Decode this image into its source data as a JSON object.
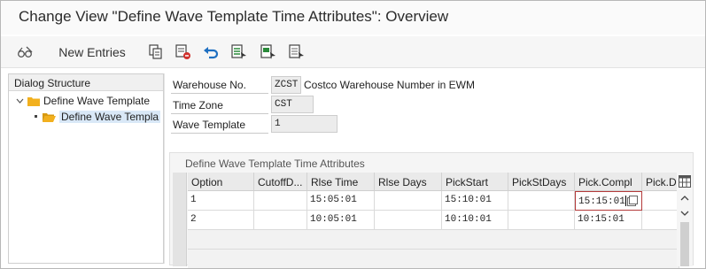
{
  "window": {
    "title": "Change View \"Define Wave Template Time Attributes\": Overview"
  },
  "toolbar": {
    "items": [
      {
        "name": "display-change-icon",
        "label": ""
      },
      {
        "name": "new-entries",
        "label": "New Entries"
      },
      {
        "name": "copy-icon",
        "label": ""
      },
      {
        "name": "delete-icon",
        "label": ""
      },
      {
        "name": "undo-icon",
        "label": ""
      },
      {
        "name": "select-all-icon",
        "label": ""
      },
      {
        "name": "select-block-icon",
        "label": ""
      },
      {
        "name": "deselect-all-icon",
        "label": ""
      }
    ],
    "new_entries_label": "New Entries"
  },
  "dialog_structure": {
    "header": "Dialog Structure",
    "items": [
      {
        "label": "Define Wave Template",
        "level": 0,
        "expanded": true
      },
      {
        "label": "Define Wave Templa",
        "level": 1,
        "selected": true
      }
    ]
  },
  "fields": {
    "warehouse_no": {
      "label": "Warehouse No.",
      "value": "ZCST",
      "description": "Costco Warehouse Number in EWM"
    },
    "time_zone": {
      "label": "Time Zone",
      "value": "CST"
    },
    "wave_template": {
      "label": "Wave Template",
      "value": "1"
    }
  },
  "table": {
    "caption": "Define Wave Template Time Attributes",
    "columns": [
      "Option",
      "CutoffD...",
      "Rlse Time",
      "Rlse Days",
      "PickStart",
      "PickStDays",
      "Pick.Compl",
      "Pick.Da"
    ],
    "rows": [
      [
        "1",
        "",
        "15:05:01",
        "",
        "15:10:01",
        "",
        "15:15:01",
        ""
      ],
      [
        "2",
        "",
        "10:05:01",
        "",
        "10:10:01",
        "",
        "10:15:01",
        ""
      ]
    ],
    "empty_rows": 2,
    "active_cell": {
      "row": 0,
      "column": 6
    },
    "table_settings_icon": "table-settings-icon"
  }
}
